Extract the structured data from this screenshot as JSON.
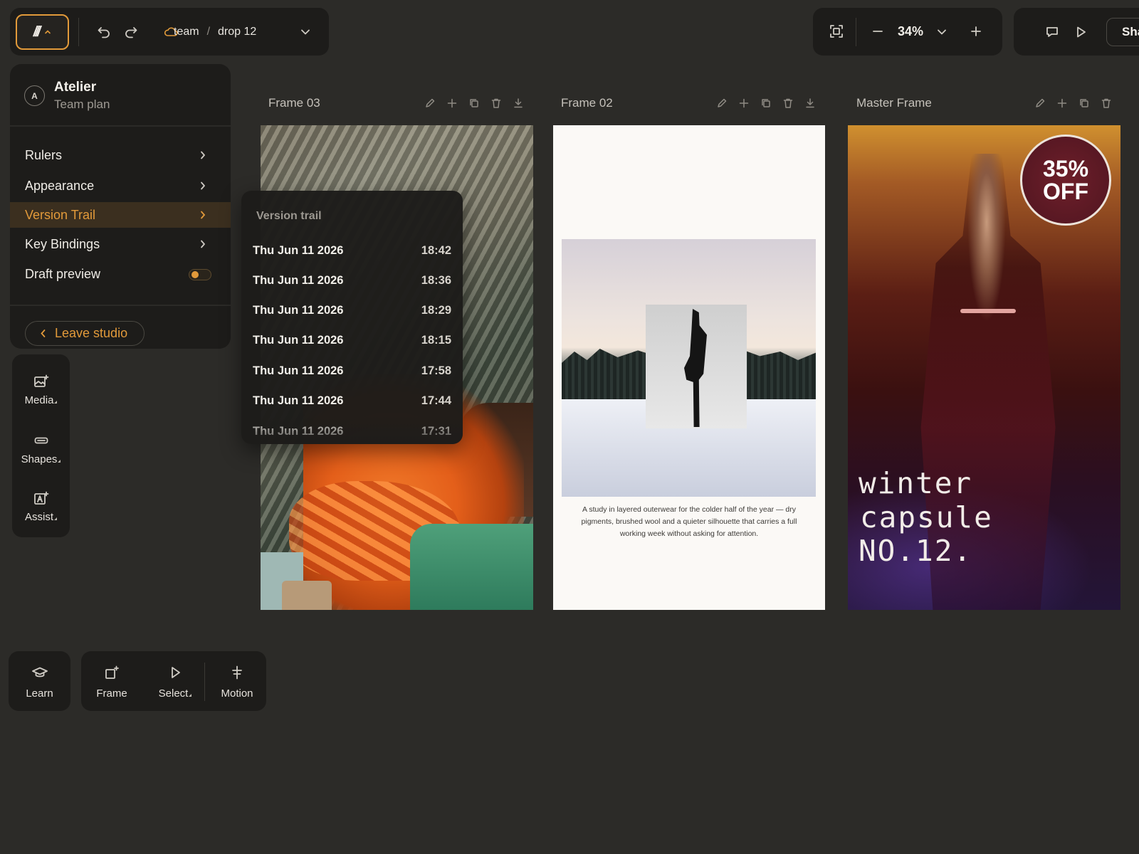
{
  "toolbar": {
    "breadcrumb": {
      "team": "team",
      "separator": "/",
      "project": "drop 12"
    },
    "zoom": "34%",
    "share_label": "Sha"
  },
  "settings_menu": {
    "avatar_initial": "A",
    "workspace_name": "Atelier",
    "workspace_plan": "Team plan",
    "items": [
      {
        "label": "Rulers"
      },
      {
        "label": "Appearance"
      },
      {
        "label": "Version Trail",
        "active": true
      },
      {
        "label": "Key Bindings"
      },
      {
        "label": "Draft preview",
        "toggle": true
      }
    ],
    "leave_label": "Leave studio"
  },
  "version_trail": {
    "title": "Version trail",
    "entries": [
      {
        "date": "Thu Jun 11 2026",
        "time": "18:42"
      },
      {
        "date": "Thu Jun 11 2026",
        "time": "18:36"
      },
      {
        "date": "Thu Jun 11 2026",
        "time": "18:29"
      },
      {
        "date": "Thu Jun 11 2026",
        "time": "18:15"
      },
      {
        "date": "Thu Jun 11 2026",
        "time": "17:58"
      },
      {
        "date": "Thu Jun 11 2026",
        "time": "17:44"
      },
      {
        "date": "Thu Jun 11 2026",
        "time": "17:31"
      }
    ]
  },
  "dock": {
    "tools": [
      {
        "label": "Media",
        "icon": "image-add-icon"
      },
      {
        "label": "Shapes",
        "icon": "shape-icon"
      },
      {
        "label": "Assist",
        "icon": "ai-assist-icon"
      }
    ]
  },
  "bottom_toolbar": {
    "learn": "Learn",
    "frame": "Frame",
    "select": "Select",
    "motion": "Motion"
  },
  "frames": {
    "frame_03": {
      "title": "Frame 03"
    },
    "frame_02": {
      "title": "Frame 02",
      "caption": "A study in layered outerwear for the colder half of the year — dry pigments, brushed wool and a quieter silhouette that carries a full working week without asking for attention."
    },
    "master": {
      "title": "Master Frame",
      "badge_line1": "35%",
      "badge_line2": "OFF",
      "promo_line1": "winter",
      "promo_line2": "capsule",
      "promo_line3": "NO.12."
    }
  },
  "colors": {
    "accent": "#e29a3a",
    "canvas": "#2c2b28",
    "panel": "#1d1c1a"
  }
}
